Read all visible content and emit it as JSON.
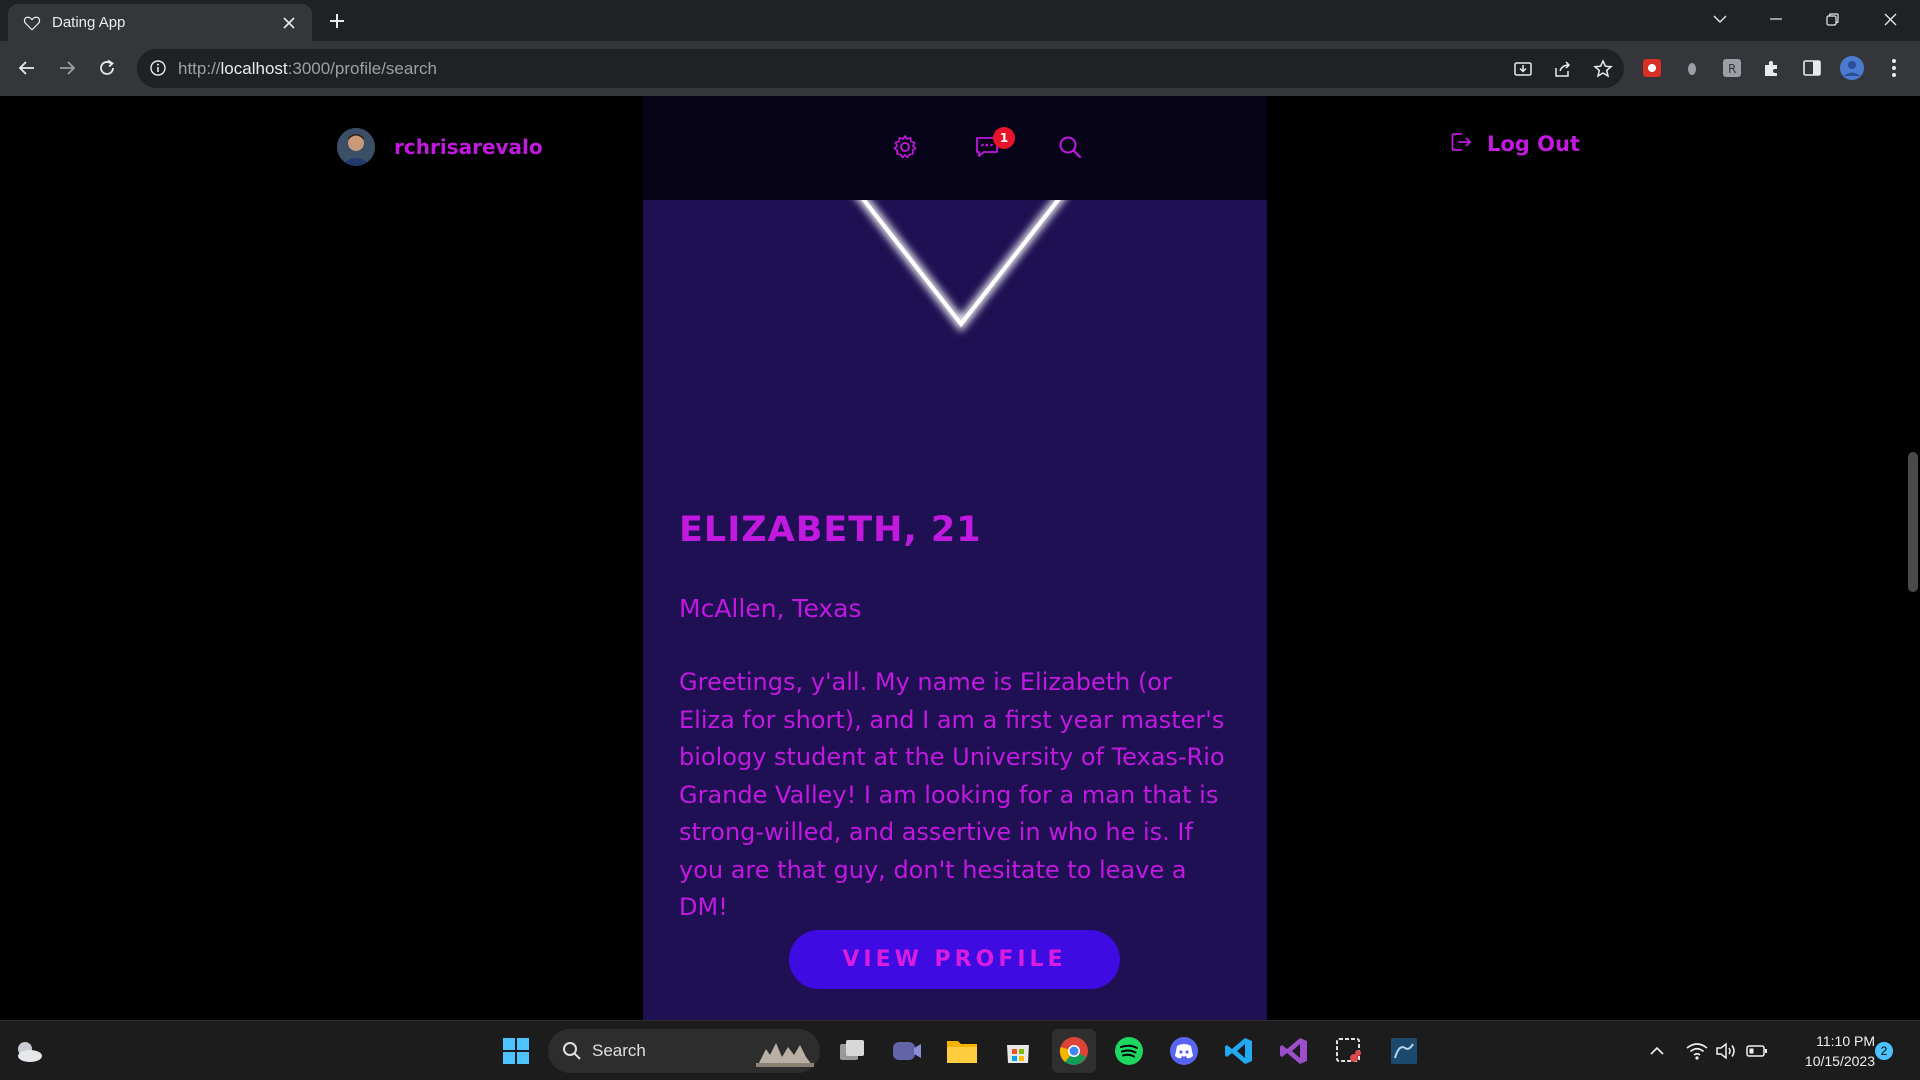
{
  "browser": {
    "tab_title": "Dating App",
    "url_scheme": "http://",
    "url_host": "localhost",
    "url_path": ":3000/profile/search"
  },
  "header": {
    "username": "rchrisarevalo",
    "messages_badge": "1",
    "logout_label": "Log Out",
    "icons": [
      "settings-icon",
      "messages-icon",
      "search-icon",
      "logout-icon"
    ]
  },
  "profile_card": {
    "name_age": "ELIZABETH, 21",
    "location": "McAllen, Texas",
    "bio": "Greetings, y'all. My name is Elizabeth (or Eliza for short), and I am a first year master's biology student at the University of Texas-Rio Grande Valley! I am looking for a man that is strong-willed, and assertive in who he is. If you are that guy, don't hesitate to leave a DM!",
    "button_label": "VIEW PROFILE"
  },
  "colors": {
    "accent": "#c219e0",
    "card_bg": "#1e1052",
    "button_bg": "#3e0be3",
    "badge": "#e8152a"
  },
  "taskbar": {
    "search_label": "Search",
    "time": "11:10 PM",
    "date": "10/15/2023",
    "notification_count": "2"
  }
}
